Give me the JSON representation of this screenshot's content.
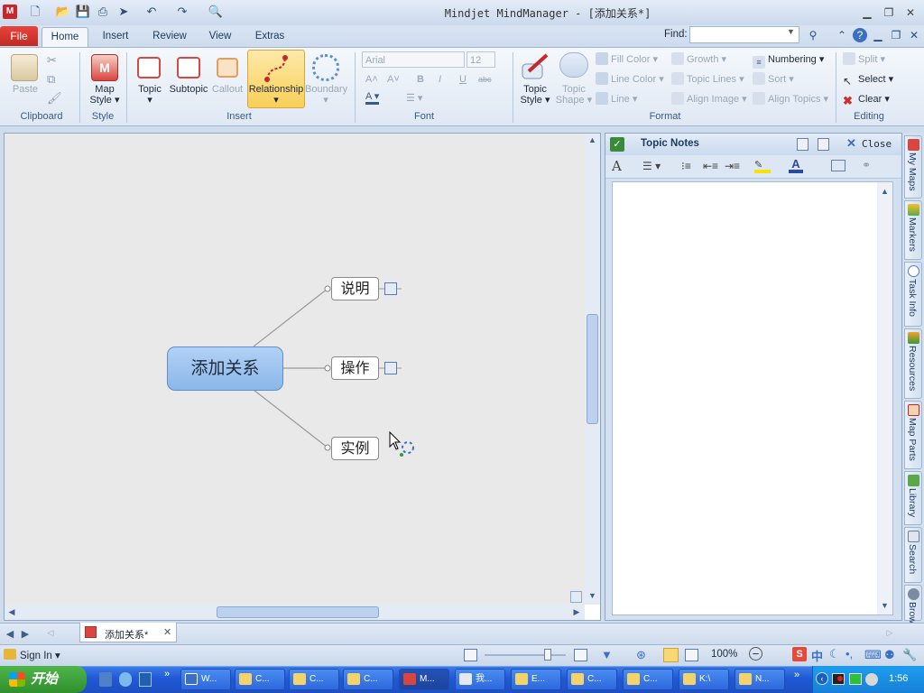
{
  "window": {
    "title": "Mindjet MindManager - [添加关系*]",
    "app_logo": "M"
  },
  "ribbon_tabs": {
    "file": "File",
    "home": "Home",
    "insert": "Insert",
    "review": "Review",
    "view": "View",
    "extras": "Extras"
  },
  "find": {
    "label": "Find:",
    "value": ""
  },
  "clipboard": {
    "paste": "Paste",
    "group": "Clipboard"
  },
  "style": {
    "map_style": "Map",
    "map_style2": "Style",
    "group": "Style"
  },
  "insert": {
    "topic": "Topic",
    "subtopic": "Subtopic",
    "callout": "Callout",
    "relationship": "Relationship",
    "boundary": "Boundary",
    "group": "Insert"
  },
  "font": {
    "name": "Arial",
    "size": "12",
    "bold": "B",
    "italic": "I",
    "underline": "U",
    "strike": "abc",
    "group": "Font"
  },
  "format": {
    "topic_style": "Topic",
    "topic_style2": "Style",
    "topic_shape": "Topic",
    "topic_shape2": "Shape",
    "fill_color": "Fill Color",
    "line_color": "Line Color",
    "line": "Line",
    "growth": "Growth",
    "topic_lines": "Topic Lines",
    "align_image": "Align Image",
    "numbering": "Numbering",
    "sort": "Sort",
    "align_topics": "Align Topics",
    "group": "Format"
  },
  "editing": {
    "split": "Split",
    "select": "Select",
    "clear": "Clear",
    "group": "Editing"
  },
  "map": {
    "central": "添加关系",
    "topics": [
      "说明",
      "操作",
      "实例"
    ]
  },
  "notes": {
    "title": "Topic Notes",
    "close": "Close",
    "content": ""
  },
  "side_tabs": [
    "My Maps",
    "Markers",
    "Task Info",
    "Resources",
    "Map Parts",
    "Library",
    "Search",
    "Browser"
  ],
  "doc_tab": {
    "label": "添加关系*"
  },
  "status": {
    "sign_in": "Sign In",
    "zoom": "100%"
  },
  "taskbar": {
    "start": "开始",
    "tasks": [
      "W...",
      "C...",
      "C...",
      "C...",
      "M...",
      "我...",
      "E...",
      "C...",
      "C...",
      "K:\\",
      "N..."
    ],
    "clock": "1:56"
  },
  "colors": {
    "relationship_highlight": "#f8cf58",
    "central_topic": "#8bb7ea",
    "taskbar": "#2058d4",
    "file_tab": "#c12b25"
  }
}
